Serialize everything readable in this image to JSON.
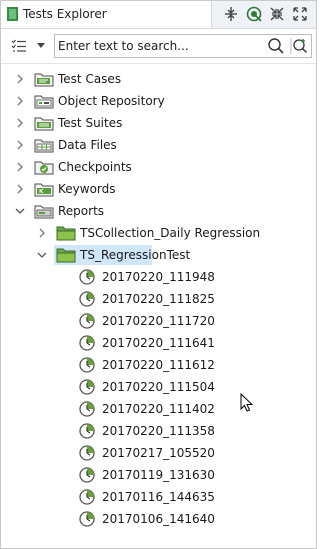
{
  "header": {
    "title": "Tests Explorer"
  },
  "toolbar": {
    "search_placeholder": "Enter text to search..."
  },
  "tree": {
    "roots": [
      "Test Cases",
      "Object Repository",
      "Test Suites",
      "Data Files",
      "Checkpoints",
      "Keywords",
      "Reports"
    ],
    "reports_children": [
      "TSCollection_Daily Regression",
      "TS_RegressionTest"
    ],
    "regression_reports": [
      "20170220_111948",
      "20170220_111825",
      "20170220_111720",
      "20170220_111641",
      "20170220_111612",
      "20170220_111504",
      "20170220_111402",
      "20170220_111358",
      "20170217_105520",
      "20170119_131630",
      "20170116_144635",
      "20170106_141640"
    ]
  },
  "colors": {
    "selection": "#cfe6fb",
    "folder_green": "#5a9e3c",
    "report_green": "#6a9e3a"
  }
}
